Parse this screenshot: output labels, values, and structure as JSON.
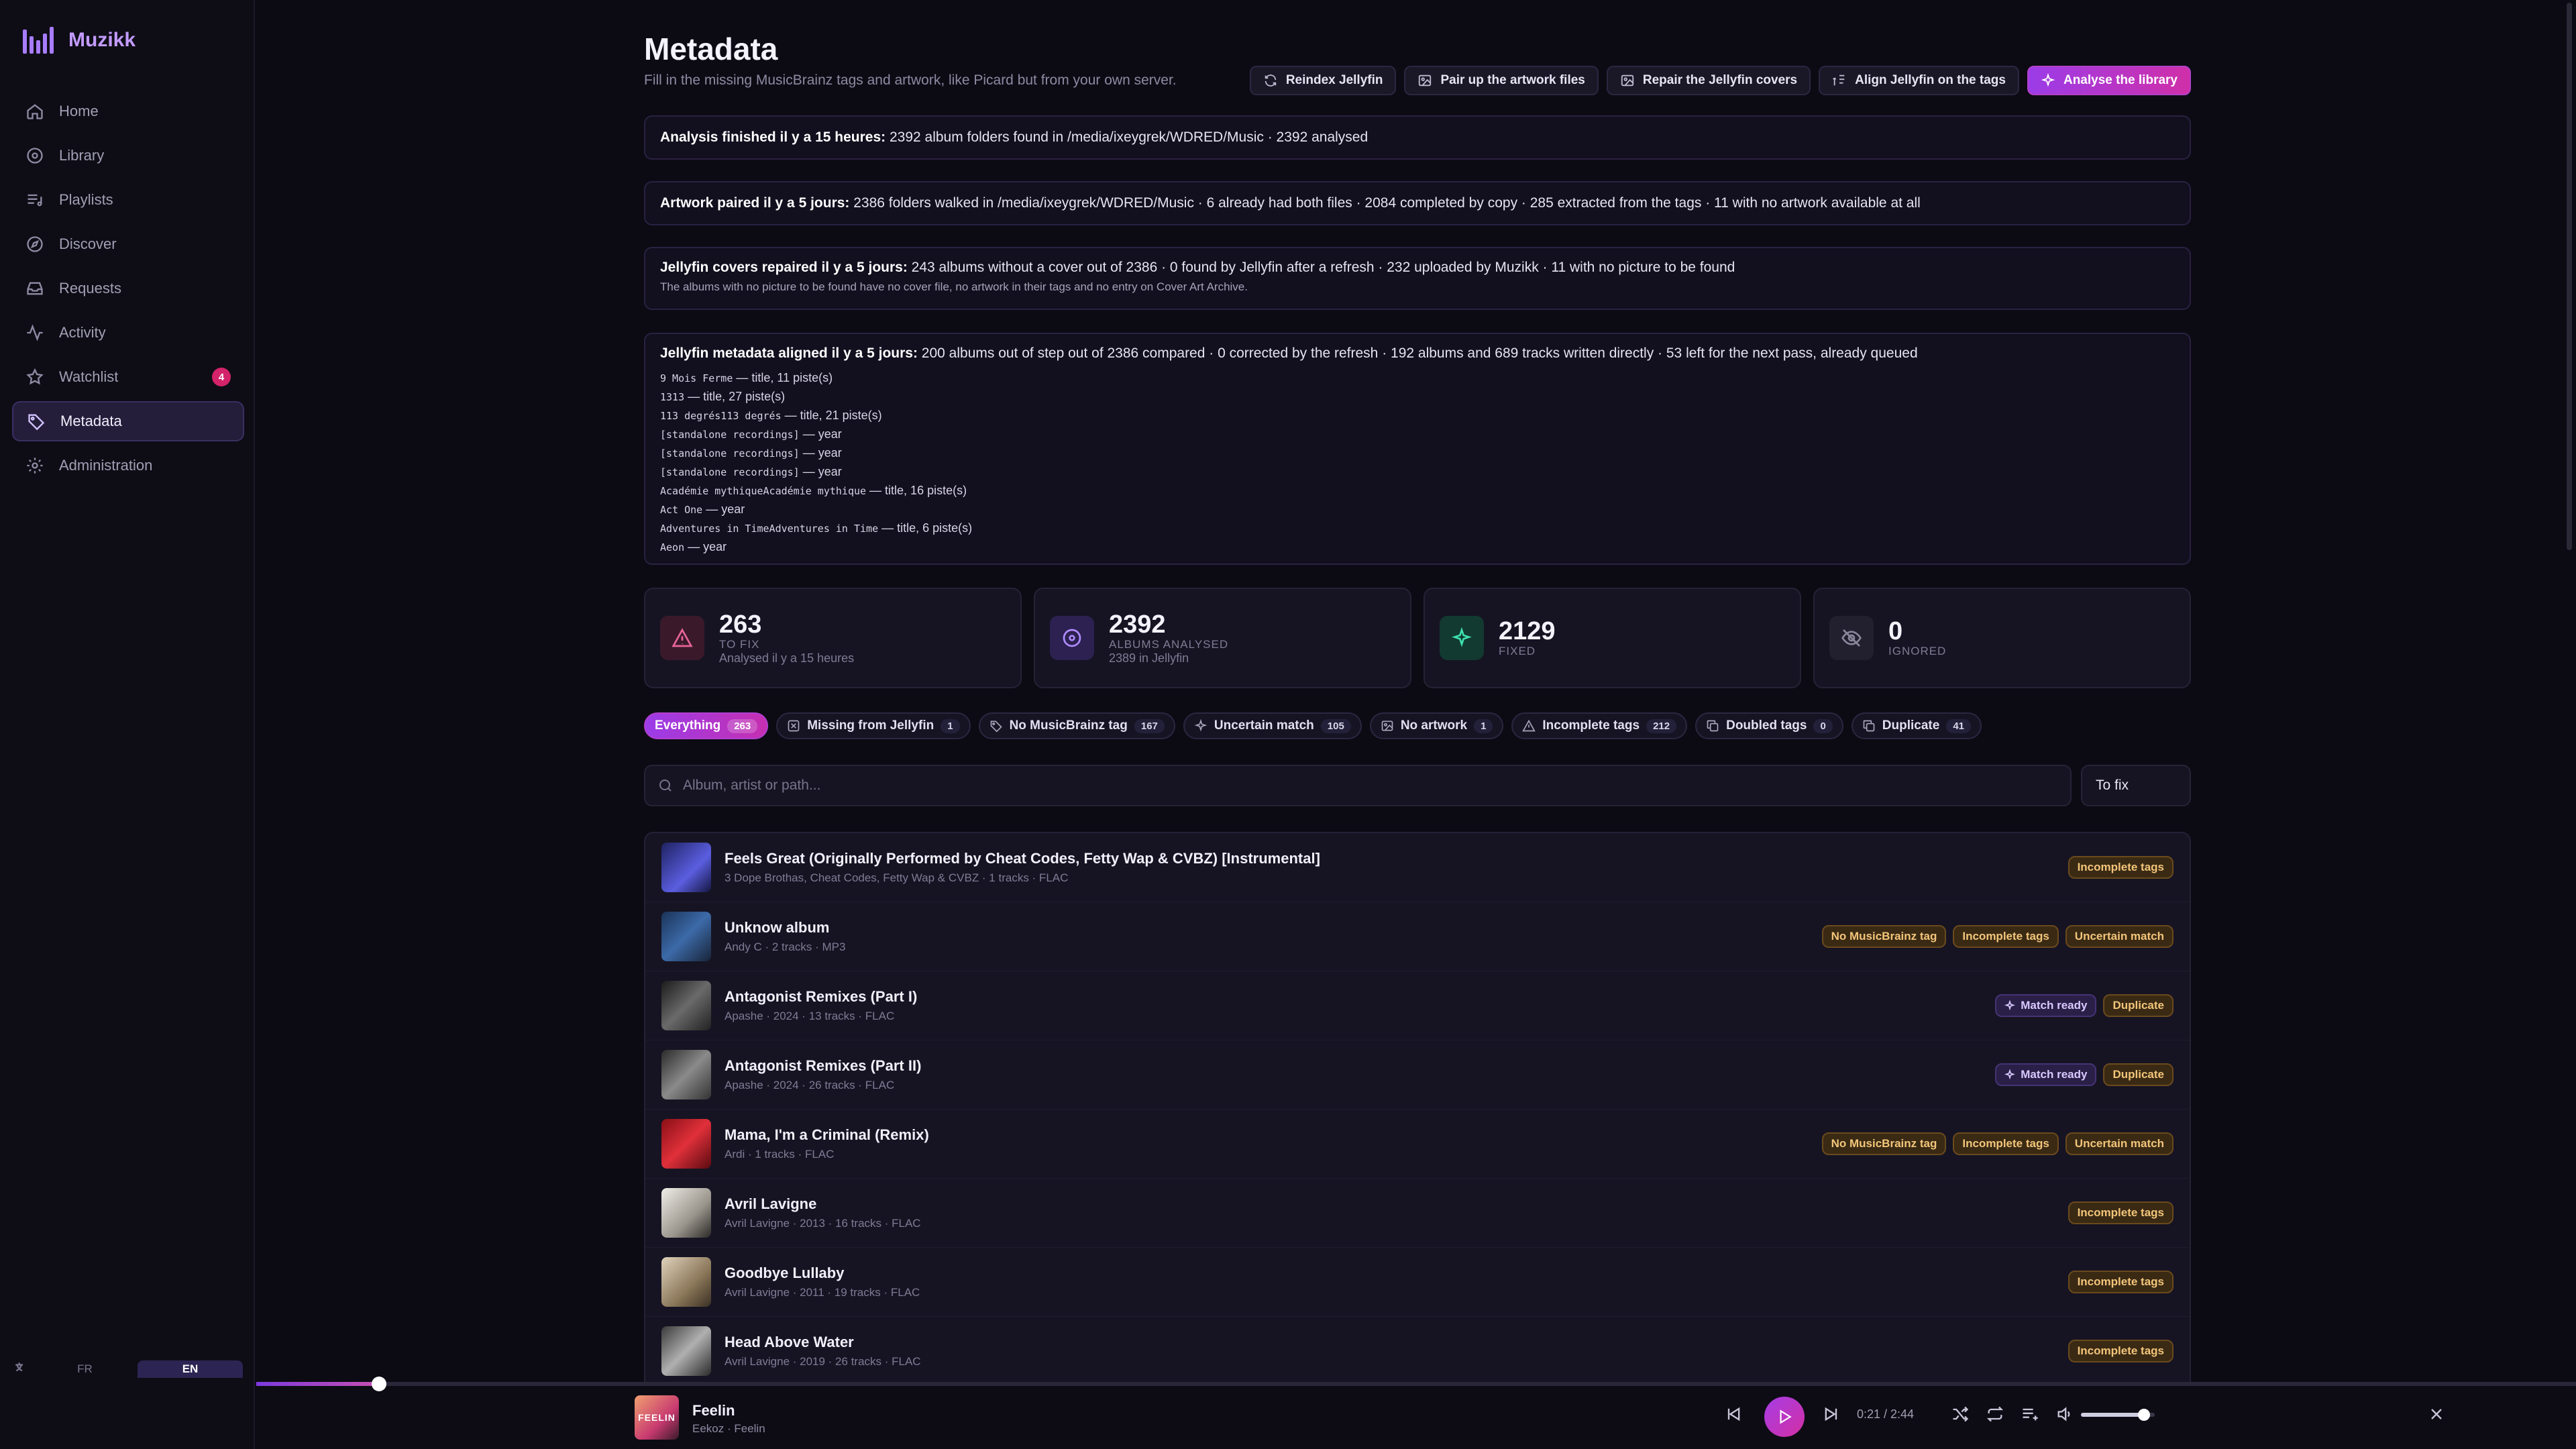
{
  "app": {
    "name": "Muzikk"
  },
  "sidebar": {
    "items": [
      {
        "label": "Home",
        "icon": "home-icon"
      },
      {
        "label": "Library",
        "icon": "library-icon"
      },
      {
        "label": "Playlists",
        "icon": "playlists-icon"
      },
      {
        "label": "Discover",
        "icon": "discover-icon"
      },
      {
        "label": "Requests",
        "icon": "requests-icon"
      },
      {
        "label": "Activity",
        "icon": "activity-icon"
      },
      {
        "label": "Watchlist",
        "icon": "star-icon",
        "badge": "4"
      },
      {
        "label": "Metadata",
        "icon": "tag-icon",
        "active": true
      },
      {
        "label": "Administration",
        "icon": "gear-icon"
      }
    ],
    "lang": {
      "fr": "FR",
      "en": "EN",
      "selected": "EN"
    }
  },
  "page": {
    "title": "Metadata",
    "subtitle": "Fill in the missing MusicBrainz tags and artwork, like Picard but from your own server.",
    "actions": [
      {
        "label": "Reindex Jellyfin",
        "icon": "refresh-icon"
      },
      {
        "label": "Pair up the artwork files",
        "icon": "image-icon"
      },
      {
        "label": "Repair the Jellyfin covers",
        "icon": "image-icon"
      },
      {
        "label": "Align Jellyfin on the tags",
        "icon": "align-icon"
      },
      {
        "label": "Analyse the library",
        "icon": "sparkle-icon",
        "primary": true
      }
    ]
  },
  "reports": {
    "analysis": {
      "head": "Analysis finished il y a 15 heures:",
      "body": " 2392 album folders found in /media/ixeygrek/WDRED/Music · 2392 analysed"
    },
    "artwork": {
      "head": "Artwork paired il y a 5 jours:",
      "body": " 2386 folders walked in /media/ixeygrek/WDRED/Music · 6 already had both files · 2084 completed by copy · 285 extracted from the tags · 11 with no artwork available at all"
    },
    "covers": {
      "head": "Jellyfin covers repaired il y a 5 jours:",
      "body": " 243 albums without a cover out of 2386 · 0 found by Jellyfin after a refresh · 232 uploaded by Muzikk · 11 with no picture to be found",
      "note": "The albums with no picture to be found have no cover file, no artwork in their tags and no entry on Cover Art Archive."
    },
    "aligned": {
      "head": "Jellyfin metadata aligned il y a 5 jours:",
      "body": " 200 albums out of step out of 2386 compared · 0 corrected by the refresh · 192 albums and 689 tracks written directly · 53 left for the next pass, already queued",
      "entries": [
        {
          "name": "9 Mois Ferme",
          "detail": " — title, 11 piste(s)"
        },
        {
          "name": "1313",
          "detail": " — title, 27 piste(s)"
        },
        {
          "name": "113 degrés113 degrés",
          "detail": " — title, 21 piste(s)"
        },
        {
          "name": "[standalone recordings]",
          "detail": " — year"
        },
        {
          "name": "[standalone recordings]",
          "detail": " — year"
        },
        {
          "name": "[standalone recordings]",
          "detail": " — year"
        },
        {
          "name": "Académie mythiqueAcadémie mythique",
          "detail": " — title, 16 piste(s)"
        },
        {
          "name": "Act One",
          "detail": " — year"
        },
        {
          "name": "Adventures in TimeAdventures in Time",
          "detail": " — title, 6 piste(s)"
        },
        {
          "name": "Aeon",
          "detail": " — year"
        }
      ]
    }
  },
  "stats": [
    {
      "value": "263",
      "label": "TO FIX",
      "sub": "Analysed il y a 15 heures",
      "icon": "warning-icon",
      "color": "#e8649a",
      "bg": "#3a1a2a"
    },
    {
      "value": "2392",
      "label": "ALBUMS ANALYSED",
      "sub": "2389 in Jellyfin",
      "icon": "disc-icon",
      "color": "#b08cff",
      "bg": "#2c2150"
    },
    {
      "value": "2129",
      "label": "FIXED",
      "sub": "",
      "icon": "sparkle-icon",
      "color": "#3ee0b0",
      "bg": "#123a30"
    },
    {
      "value": "0",
      "label": "IGNORED",
      "sub": "",
      "icon": "eye-off-icon",
      "color": "#8a879c",
      "bg": "#22202f"
    }
  ],
  "filters": [
    {
      "label": "Everything",
      "count": "263",
      "active": true,
      "icon": ""
    },
    {
      "label": "Missing from Jellyfin",
      "count": "1",
      "icon": "box-icon"
    },
    {
      "label": "No MusicBrainz tag",
      "count": "167",
      "icon": "tag-icon"
    },
    {
      "label": "Uncertain match",
      "count": "105",
      "icon": "sparkle-icon"
    },
    {
      "label": "No artwork",
      "count": "1",
      "icon": "image-icon"
    },
    {
      "label": "Incomplete tags",
      "count": "212",
      "icon": "warning-icon"
    },
    {
      "label": "Doubled tags",
      "count": "0",
      "icon": "copy-icon"
    },
    {
      "label": "Duplicate",
      "count": "41",
      "icon": "copy-icon"
    }
  ],
  "search": {
    "placeholder": "Album, artist or path...",
    "status": "To fix"
  },
  "albums": [
    {
      "title": "Feels Great (Originally Performed by Cheat Codes, Fetty Wap & CVBZ) [Instrumental]",
      "meta": "3 Dope Brothas, Cheat Codes, Fetty Wap & CVBZ · 1 tracks · FLAC",
      "tags": [
        "Incomplete tags"
      ],
      "cover": "#3b3fa8"
    },
    {
      "title": "Unknow album",
      "meta": "Andy C · 2 tracks · MP3",
      "tags": [
        "No MusicBrainz tag",
        "Incomplete tags",
        "Uncertain match"
      ],
      "cover": "#24406a"
    },
    {
      "title": "Antagonist Remixes (Part I)",
      "meta": "Apashe · 2024 · 13 tracks · FLAC",
      "tags": [
        "Match ready",
        "Duplicate"
      ],
      "cover": "#3a3a3a"
    },
    {
      "title": "Antagonist Remixes (Part II)",
      "meta": "Apashe · 2024 · 26 tracks · FLAC",
      "tags": [
        "Match ready",
        "Duplicate"
      ],
      "cover": "#505050"
    },
    {
      "title": "Mama, I'm a Criminal (Remix)",
      "meta": "Ardi · 1 tracks · FLAC",
      "tags": [
        "No MusicBrainz tag",
        "Incomplete tags",
        "Uncertain match"
      ],
      "cover": "#c0202a"
    },
    {
      "title": "Avril Lavigne",
      "meta": "Avril Lavigne · 2013 · 16 tracks · FLAC",
      "tags": [
        "Incomplete tags"
      ],
      "cover": "#cfcac2"
    },
    {
      "title": "Goodbye Lullaby",
      "meta": "Avril Lavigne · 2011 · 19 tracks · FLAC",
      "tags": [
        "Incomplete tags"
      ],
      "cover": "#b3a48e"
    },
    {
      "title": "Head Above Water",
      "meta": "Avril Lavigne · 2019 · 26 tracks · FLAC",
      "tags": [
        "Incomplete tags"
      ],
      "cover": "#8d8d8d"
    }
  ],
  "player": {
    "title": "Feelin",
    "sub": "Eekoz · Feelin",
    "cover_text": "FEELIN",
    "time": "0:21 / 2:44",
    "progress": 0.053,
    "volume": 0.85
  }
}
